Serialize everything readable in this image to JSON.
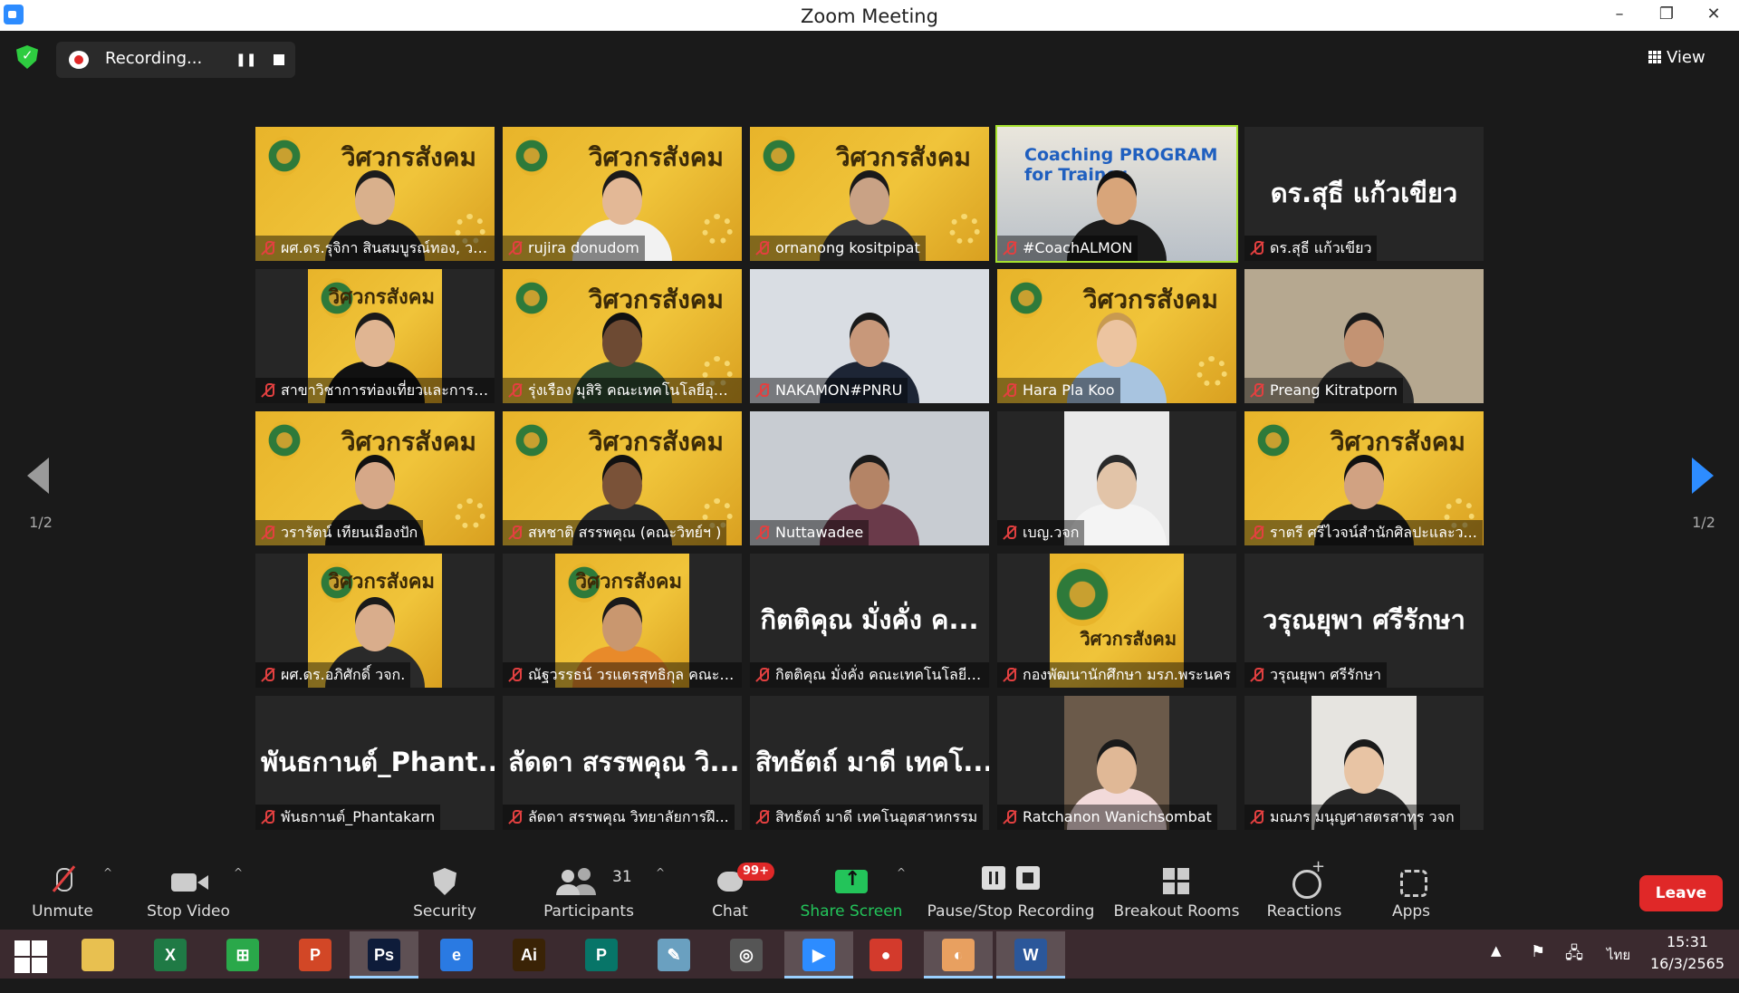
{
  "window": {
    "title": "Zoom Meeting"
  },
  "topbar": {
    "recording_text": "Recording...",
    "view_label": "View"
  },
  "pager": {
    "left": "1/2",
    "right": "1/2"
  },
  "participants": [
    {
      "name": "ผศ.ดร.รุจิกา สินสมบูรณ์ทอง, วจ...",
      "kind": "banner-person",
      "skin": "#d9b08c",
      "shirt": "#222222",
      "hair": "#1c1c1c"
    },
    {
      "name": "rujira donudom",
      "kind": "banner-person",
      "skin": "#e3b896",
      "shirt": "#f2f2f2",
      "hair": "#1a1a1a"
    },
    {
      "name": "ornanong kositpipat",
      "kind": "banner-person",
      "skin": "#c9a285",
      "shirt": "#3a3a3a",
      "hair": "#1a1a1a"
    },
    {
      "name": "#CoachALMON",
      "kind": "coach",
      "coach_text": "Coaching PROGRAM for Trainer",
      "skin": "#d8a57a",
      "shirt": "#1b1b1b",
      "hair": "#111111",
      "active": true
    },
    {
      "name": "ดร.สุธี แก้วเขียว",
      "kind": "text",
      "big": "ดร.สุธี แก้วเขียว"
    },
    {
      "name": "สาขาวิชาการท่องเที่ยวและการโร...",
      "kind": "banner-inset",
      "skin": "#e0b592",
      "shirt": "#111111",
      "hair": "#1a1a1a"
    },
    {
      "name": "รุ่งเรือง มุสิริ คณะเทคโนโลยีอุตส...",
      "kind": "banner-person",
      "skin": "#6d4a33",
      "shirt": "#2e4a30",
      "hair": "#111111"
    },
    {
      "name": "NAKAMON#PNRU",
      "kind": "photo",
      "bg": "#d9dde3",
      "skin": "#c8987a",
      "shirt": "#1d2535",
      "hair": "#1a1a1a"
    },
    {
      "name": "Hara Pla Koo",
      "kind": "banner-person",
      "skin": "#ecc4a0",
      "shirt": "#a8c4e0",
      "hair": "#c89a50"
    },
    {
      "name": "Preang Kitratporn",
      "kind": "photo",
      "bg": "#b6a890",
      "skin": "#c39373",
      "shirt": "#2a2a2a",
      "hair": "#1a1a1a"
    },
    {
      "name": "วรารัตน์ เทียนเมืองปัก",
      "kind": "banner-person",
      "skin": "#d6a888",
      "shirt": "#1c1c1c",
      "hair": "#111111"
    },
    {
      "name": "สหชาติ สรรพคุณ (คณะวิทย์ฯ )",
      "kind": "banner-person",
      "skin": "#7a5238",
      "shirt": "#2a2a2a",
      "hair": "#111111"
    },
    {
      "name": "Nuttawadee",
      "kind": "photo",
      "bg": "#c8ccd2",
      "skin": "#b48466",
      "shirt": "#6a3a4a",
      "hair": "#1a1a1a"
    },
    {
      "name": "เบญ.วจก",
      "kind": "photo-inset",
      "bg": "#eaeaea",
      "skin": "#e2c4a8",
      "shirt": "#f4f4f4",
      "hair": "#2a2a2a"
    },
    {
      "name": "ราตรี ศรีไวจน์สำนักศิลปะและว...",
      "kind": "banner-person",
      "skin": "#d1a282",
      "shirt": "#1d1d1d",
      "hair": "#111111"
    },
    {
      "name": "ผศ.ดร.อภิศักดิ์ วจก.",
      "kind": "banner-inset",
      "skin": "#d9ad8c",
      "shirt": "#2a2a2a",
      "hair": "#1a1a1a"
    },
    {
      "name": "ณัฐวรรธน์ วรแตรสุทธิกุล คณะเ...",
      "kind": "banner-inset",
      "skin": "#c9976f",
      "shirt": "#e88a2a",
      "hair": "#1a1a1a"
    },
    {
      "name": "กิตติคุณ มั่งคั่ง คณะเทคโนโลยีอ...",
      "kind": "text",
      "big": "กิตติคุณ มั่งคั่ง ค..."
    },
    {
      "name": "กองพัฒนานักศึกษา มรภ.พระนคร",
      "kind": "banner-logo"
    },
    {
      "name": "วรุณยุพา ศรีรักษา",
      "kind": "text",
      "big": "วรุณยุพา ศรีรักษา"
    },
    {
      "name": "พันธกานต์_Phantakarn",
      "kind": "text",
      "big": "พันธกานต์_Phant..."
    },
    {
      "name": "ลัดดา สรรพคุณ วิทยาลัยการฝึ...",
      "kind": "text",
      "big": "ลัดดา สรรพคุณ วิ..."
    },
    {
      "name": "สิทธัตถ์ มาดี เทคโนอุตสาหกรรม",
      "kind": "text",
      "big": "สิทธัตถ์ มาดี เทคโ..."
    },
    {
      "name": "Ratchanon Wanichsombat",
      "kind": "photo-inset",
      "bg": "#6b5a4a",
      "skin": "#e0b896",
      "shirt": "#f2dada",
      "hair": "#1a1a1a"
    },
    {
      "name": "มณภร มนุญศาสตรสาทร วจก",
      "kind": "photo-inset",
      "bg": "#e6e4e0",
      "skin": "#e8c4a4",
      "shirt": "#2a2a2a",
      "hair": "#1a1a1a"
    }
  ],
  "banner_text": "วิศวกรสังคม",
  "toolbar": {
    "unmute": "Unmute",
    "stop_video": "Stop Video",
    "security": "Security",
    "participants": "Participants",
    "participants_count": "31",
    "chat": "Chat",
    "chat_badge": "99+",
    "share_screen": "Share Screen",
    "pause_stop_recording": "Pause/Stop Recording",
    "breakout_rooms": "Breakout Rooms",
    "reactions": "Reactions",
    "apps": "Apps",
    "leave": "Leave"
  },
  "taskbar": {
    "apps": [
      {
        "name": "file-explorer",
        "glyph": "",
        "color": "#e8c050"
      },
      {
        "name": "excel",
        "glyph": "X",
        "color": "#1f7a45"
      },
      {
        "name": "store",
        "glyph": "⊞",
        "color": "#2aa84a"
      },
      {
        "name": "powerpoint",
        "glyph": "P",
        "color": "#d24726"
      },
      {
        "name": "photoshop",
        "glyph": "Ps",
        "color": "#0e1c3a"
      },
      {
        "name": "internet-explorer",
        "glyph": "e",
        "color": "#2a7ae2"
      },
      {
        "name": "illustrator",
        "glyph": "Ai",
        "color": "#3a2306"
      },
      {
        "name": "publisher",
        "glyph": "P",
        "color": "#077568"
      },
      {
        "name": "pen-tool",
        "glyph": "✎",
        "color": "#6aa0c0"
      },
      {
        "name": "photoscape",
        "glyph": "◎",
        "color": "#555555"
      },
      {
        "name": "zoom",
        "glyph": "▶",
        "color": "#2d8cff"
      },
      {
        "name": "chrome",
        "glyph": "●",
        "color": "#d33a2c"
      },
      {
        "name": "photo-viewer",
        "glyph": "◐",
        "color": "#e8a060"
      },
      {
        "name": "word",
        "glyph": "W",
        "color": "#2b579a"
      }
    ],
    "language": "ไทย",
    "time": "15:31",
    "date": "16/3/2565"
  }
}
